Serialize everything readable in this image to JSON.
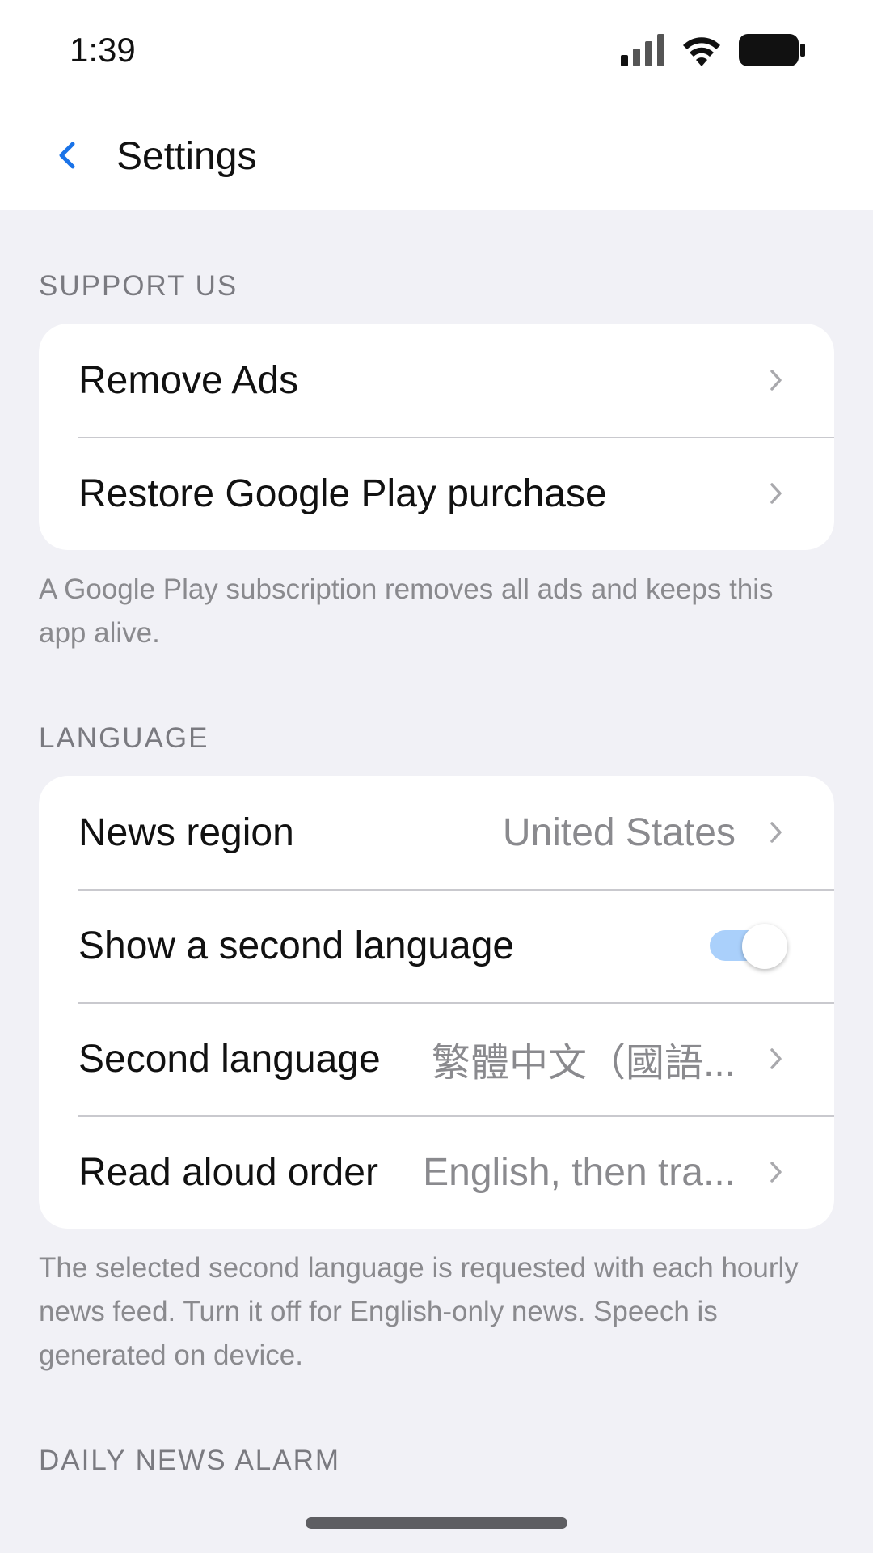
{
  "status_bar": {
    "time": "1:39",
    "icons": [
      "signal-icon",
      "wifi-icon",
      "battery-icon"
    ]
  },
  "nav": {
    "back_icon": "chevron-left-icon",
    "title": "Settings",
    "accent_color": "#1a73e8"
  },
  "sections": {
    "support": {
      "header": "SUPPORT US",
      "rows": [
        {
          "label": "Remove Ads"
        },
        {
          "label": "Restore Google Play purchase"
        }
      ],
      "footnote": "A Google Play subscription removes all ads and keeps this app alive."
    },
    "language": {
      "header": "LANGUAGE",
      "rows": [
        {
          "label": "News region",
          "value": "United States"
        },
        {
          "label": "Show a second language",
          "toggle_on": true
        },
        {
          "label": "Second language",
          "value": "繁體中文（國語..."
        },
        {
          "label": "Read aloud order",
          "value": "English, then tra..."
        }
      ],
      "footnote": "The selected second language is requested with each hourly news feed. Turn it off for English-only news. Speech is generated on device."
    },
    "alarm": {
      "header": "DAILY NEWS ALARM"
    }
  }
}
